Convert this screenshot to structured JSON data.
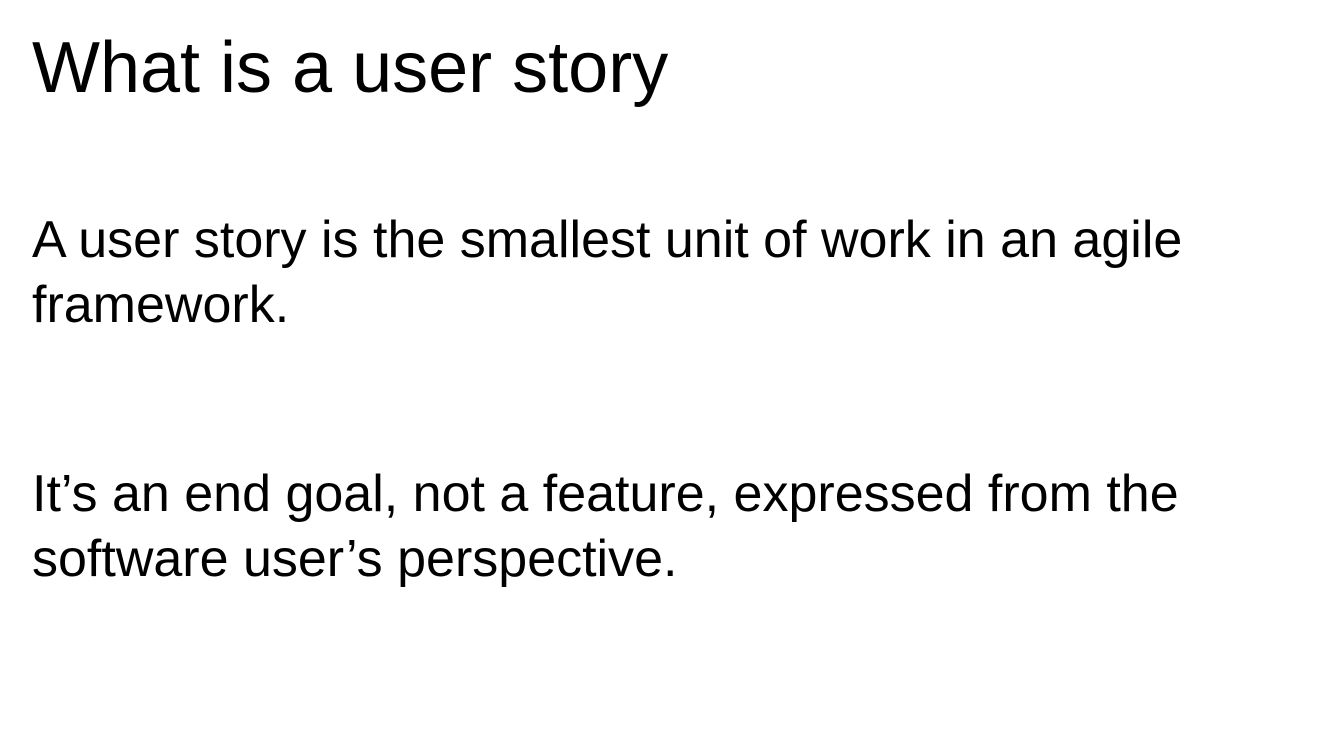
{
  "slide": {
    "title": "What is a user story",
    "paragraphs": [
      "A user story is the smallest unit of work in an agile framework.",
      "It’s an end goal, not a feature, expressed from the software user’s perspective."
    ]
  }
}
